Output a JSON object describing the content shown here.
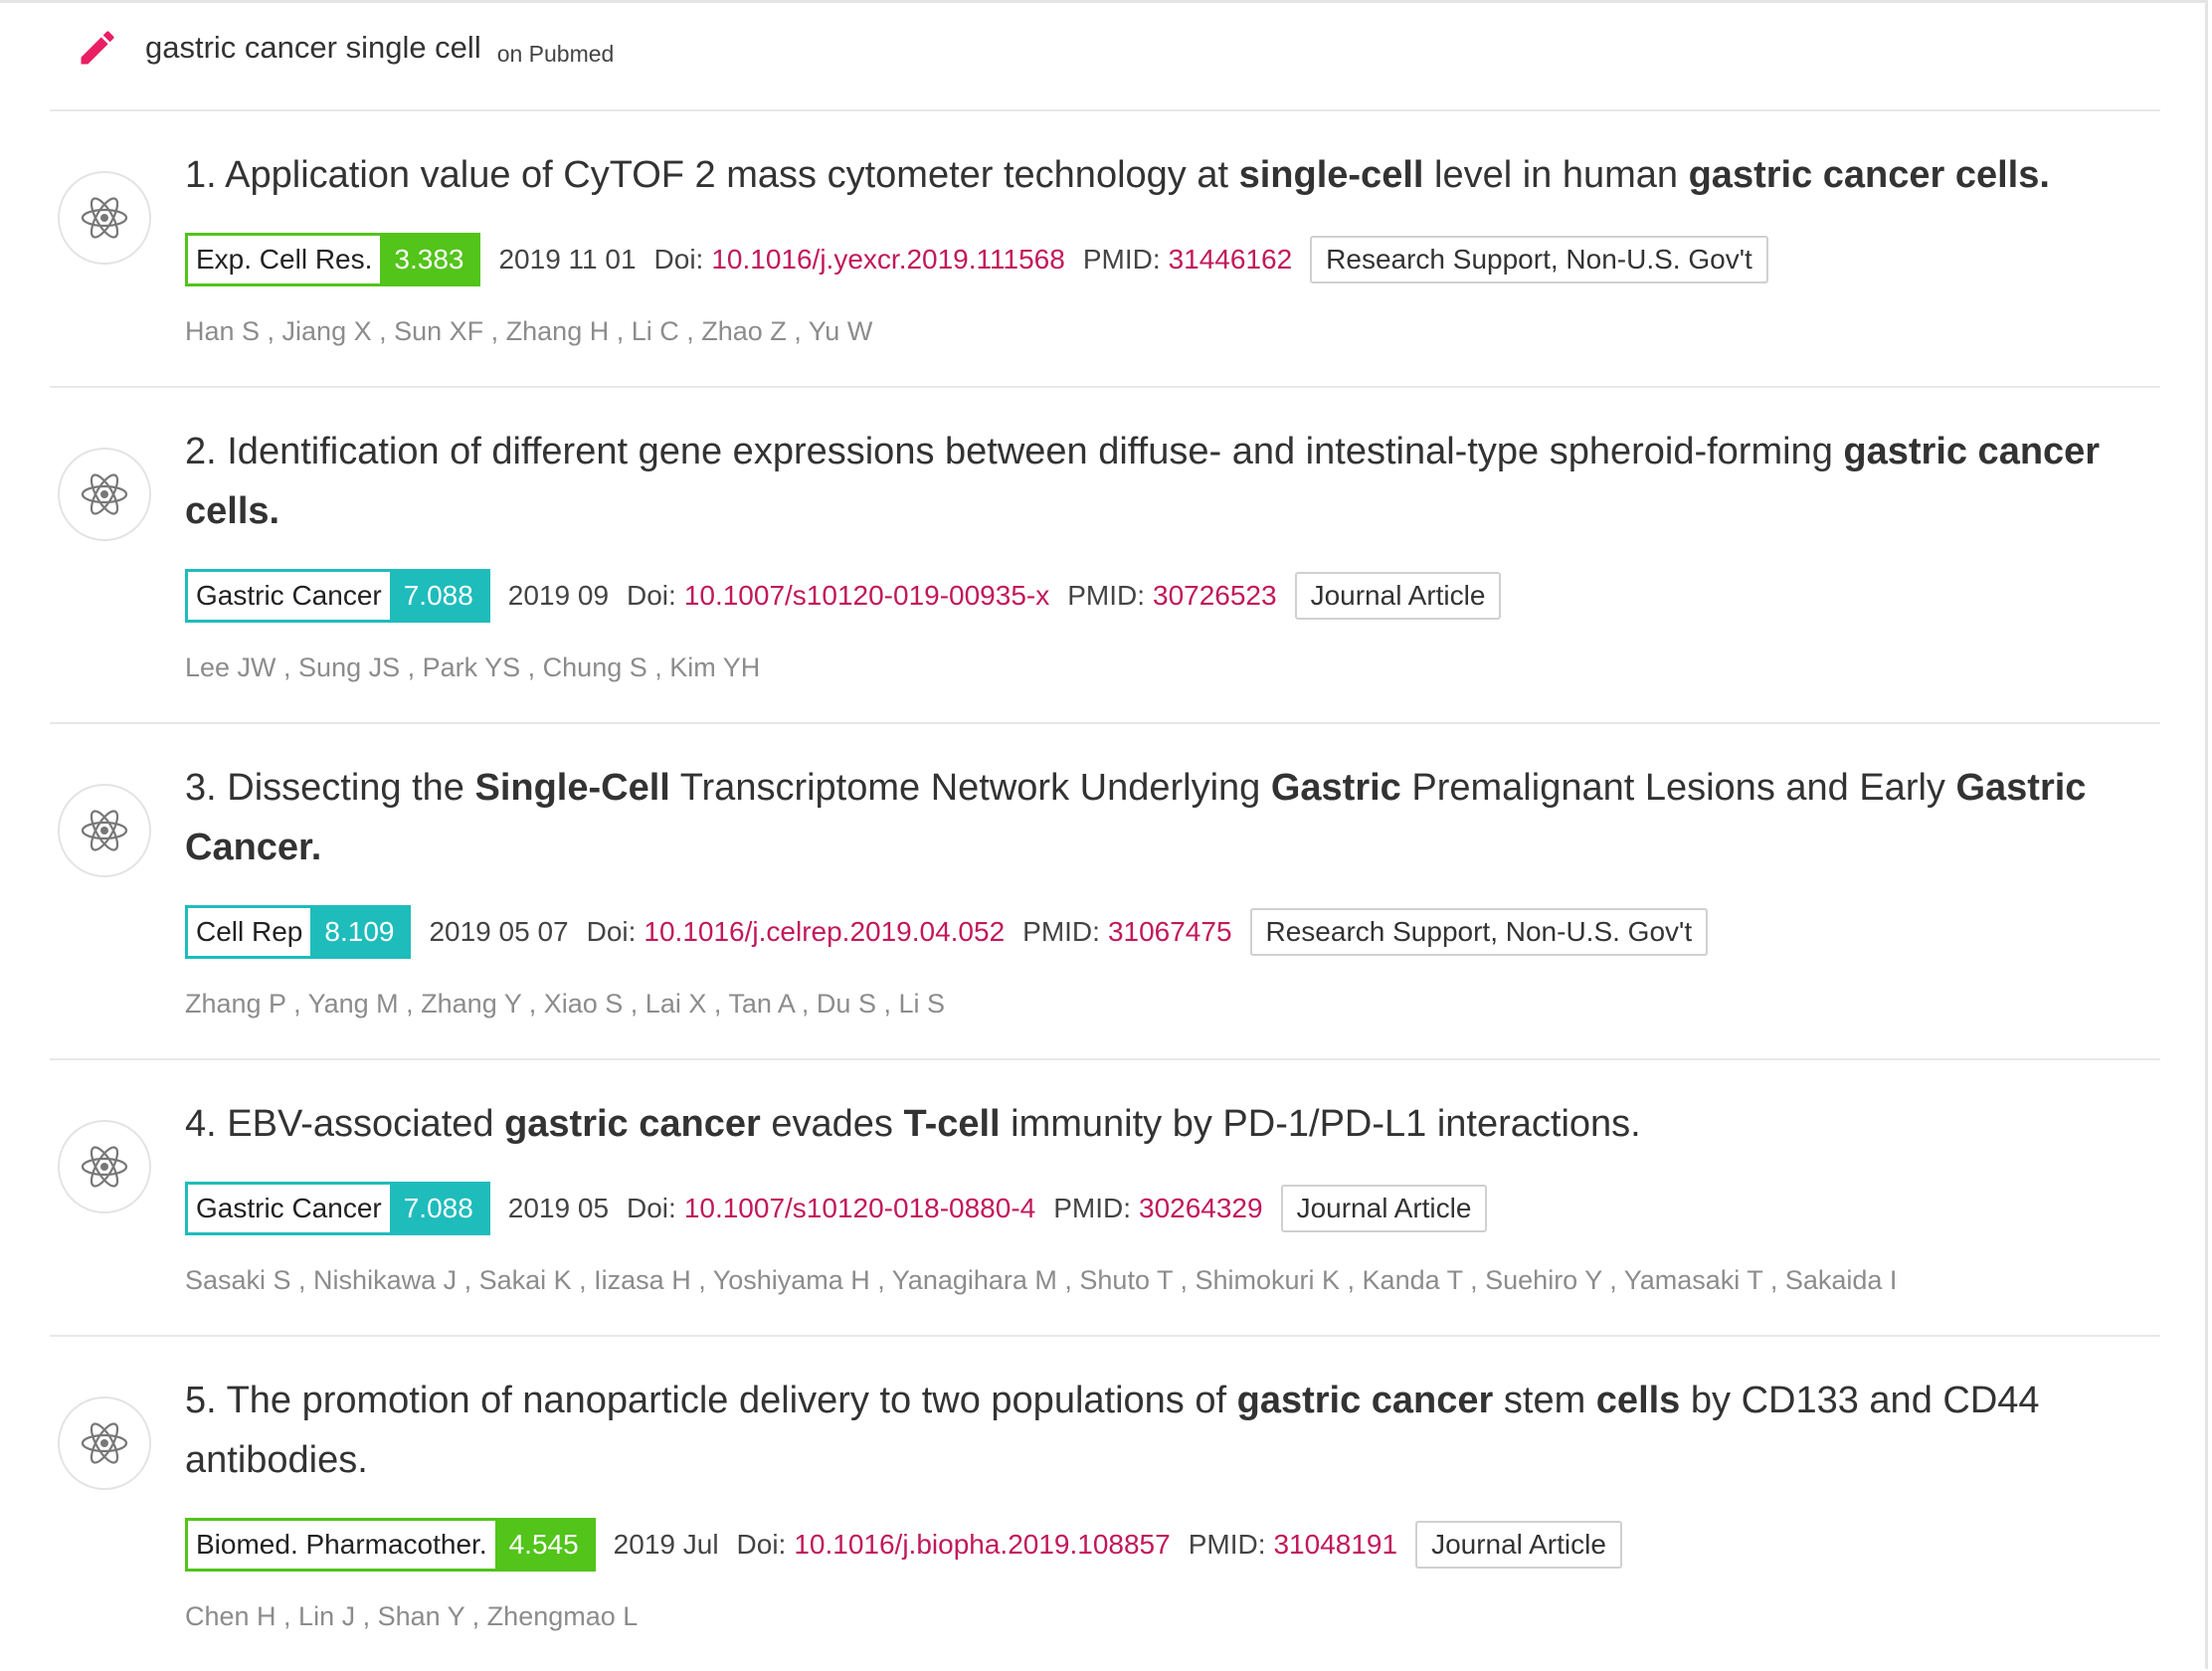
{
  "search": {
    "query": "gastric cancer single cell",
    "source": "on Pubmed",
    "icon": "pencil-icon"
  },
  "colors": {
    "accent_pink": "#e91e63",
    "link": "#c2185b",
    "if_green": "#52c41a",
    "if_teal": "#1fbcbc"
  },
  "articles": [
    {
      "index": "1.",
      "title_parts": [
        {
          "t": "Application value of CyTOF 2 mass cytometer technology at ",
          "b": false
        },
        {
          "t": "single-cell",
          "b": true
        },
        {
          "t": " level in human ",
          "b": false
        },
        {
          "t": "gastric cancer cells.",
          "b": true
        }
      ],
      "journal": "Exp. Cell Res.",
      "impact_factor": "3.383",
      "if_color": "green",
      "date": "2019 11 01",
      "doi_label": "Doi:",
      "doi": "10.1016/j.yexcr.2019.111568",
      "pmid_label": "PMID:",
      "pmid": "31446162",
      "pub_type": "Research Support, Non-U.S. Gov't",
      "authors": "Han S , Jiang X , Sun XF , Zhang H , Li C , Zhao Z , Yu W"
    },
    {
      "index": "2.",
      "title_parts": [
        {
          "t": "Identification of different gene expressions between diffuse- and intestinal-type spheroid-forming ",
          "b": false
        },
        {
          "t": "gastric cancer cells.",
          "b": true
        }
      ],
      "journal": "Gastric Cancer",
      "impact_factor": "7.088",
      "if_color": "teal",
      "date": "2019 09",
      "doi_label": "Doi:",
      "doi": "10.1007/s10120-019-00935-x",
      "pmid_label": "PMID:",
      "pmid": "30726523",
      "pub_type": "Journal Article",
      "authors": "Lee JW , Sung JS , Park YS , Chung S , Kim YH"
    },
    {
      "index": "3.",
      "title_parts": [
        {
          "t": "Dissecting the ",
          "b": false
        },
        {
          "t": "Single-Cell",
          "b": true
        },
        {
          "t": " Transcriptome Network Underlying ",
          "b": false
        },
        {
          "t": "Gastric",
          "b": true
        },
        {
          "t": " Premalignant Lesions and Early ",
          "b": false
        },
        {
          "t": "Gastric Cancer.",
          "b": true
        }
      ],
      "journal": "Cell Rep",
      "impact_factor": "8.109",
      "if_color": "teal",
      "date": "2019 05 07",
      "doi_label": "Doi:",
      "doi": "10.1016/j.celrep.2019.04.052",
      "pmid_label": "PMID:",
      "pmid": "31067475",
      "pub_type": "Research Support, Non-U.S. Gov't",
      "authors": "Zhang P , Yang M , Zhang Y , Xiao S , Lai X , Tan A , Du S , Li S"
    },
    {
      "index": "4.",
      "title_parts": [
        {
          "t": "EBV-associated ",
          "b": false
        },
        {
          "t": "gastric cancer",
          "b": true
        },
        {
          "t": " evades ",
          "b": false
        },
        {
          "t": "T-cell",
          "b": true
        },
        {
          "t": " immunity by PD-1/PD-L1 interactions.",
          "b": false
        }
      ],
      "journal": "Gastric Cancer",
      "impact_factor": "7.088",
      "if_color": "teal",
      "date": "2019 05",
      "doi_label": "Doi:",
      "doi": "10.1007/s10120-018-0880-4",
      "pmid_label": "PMID:",
      "pmid": "30264329",
      "pub_type": "Journal Article",
      "authors": "Sasaki S , Nishikawa J , Sakai K , Iizasa H , Yoshiyama H , Yanagihara M , Shuto T , Shimokuri K , Kanda T , Suehiro Y , Yamasaki T , Sakaida I"
    },
    {
      "index": "5.",
      "title_parts": [
        {
          "t": "The promotion of nanoparticle delivery to two populations of ",
          "b": false
        },
        {
          "t": "gastric cancer",
          "b": true
        },
        {
          "t": " stem ",
          "b": false
        },
        {
          "t": "cells",
          "b": true
        },
        {
          "t": " by CD133 and CD44 antibodies.",
          "b": false
        }
      ],
      "journal": "Biomed. Pharmacother.",
      "impact_factor": "4.545",
      "if_color": "green",
      "date": "2019 Jul",
      "doi_label": "Doi:",
      "doi": "10.1016/j.biopha.2019.108857",
      "pmid_label": "PMID:",
      "pmid": "31048191",
      "pub_type": "Journal Article",
      "authors": "Chen H , Lin J , Shan Y , Zhengmao L"
    }
  ]
}
